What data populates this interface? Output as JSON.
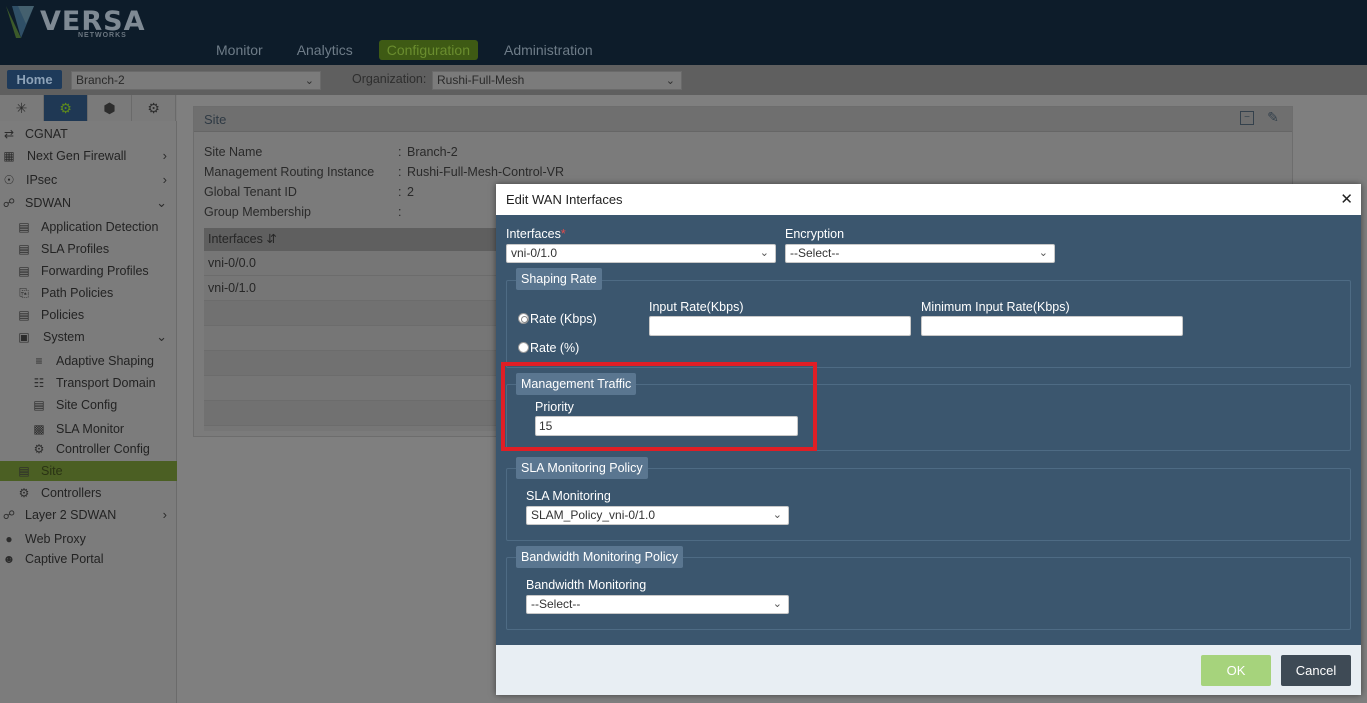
{
  "brand": {
    "name": "VERSA",
    "sub": "NETWORKS"
  },
  "nav": {
    "items": [
      "Monitor",
      "Analytics",
      "Configuration",
      "Administration"
    ],
    "active": "Configuration"
  },
  "subbar": {
    "home": "Home",
    "appliance": "Branch-2",
    "org_label": "Organization:",
    "org": "Rushi-Full-Mesh"
  },
  "sidebar": {
    "tab_icons": [
      "network-icon",
      "gear-icon",
      "cube-icon",
      "globe-gear-icon"
    ],
    "items": [
      {
        "label": "CGNAT",
        "icon": "nat-icon"
      },
      {
        "label": "Next Gen Firewall",
        "icon": "firewall-icon"
      },
      {
        "label": "IPsec",
        "icon": "globe-lock-icon"
      },
      {
        "label": "SDWAN",
        "icon": "sdwan-icon"
      },
      {
        "label": "Application Detection",
        "icon": "doc-icon"
      },
      {
        "label": "SLA Profiles",
        "icon": "doc-icon"
      },
      {
        "label": "Forwarding Profiles",
        "icon": "forward-icon"
      },
      {
        "label": "Path Policies",
        "icon": "path-icon"
      },
      {
        "label": "Policies",
        "icon": "policy-icon"
      },
      {
        "label": "System",
        "icon": "window-icon"
      },
      {
        "label": "Adaptive Shaping",
        "icon": "shaping-icon"
      },
      {
        "label": "Transport Domain",
        "icon": "transport-icon"
      },
      {
        "label": "Site Config",
        "icon": "doc-icon"
      },
      {
        "label": "SLA Monitor",
        "icon": "monitor-icon"
      },
      {
        "label": "Controller Config",
        "icon": "gear-net-icon"
      },
      {
        "label": "Site",
        "icon": "doc-icon"
      },
      {
        "label": "Controllers",
        "icon": "gear-net-icon"
      },
      {
        "label": "Layer 2 SDWAN",
        "icon": "sdwan-icon"
      },
      {
        "label": "Web Proxy",
        "icon": "proxy-icon"
      },
      {
        "label": "Captive Portal",
        "icon": "user-icon"
      }
    ]
  },
  "site": {
    "title": "Site",
    "fields": [
      {
        "key": "Site Name",
        "value": "Branch-2"
      },
      {
        "key": "Management Routing Instance",
        "value": "Rushi-Full-Mesh-Control-VR"
      },
      {
        "key": "Global Tenant ID",
        "value": "2"
      },
      {
        "key": "Group Membership",
        "value": ""
      }
    ],
    "interfaces_header": "Interfaces",
    "interfaces": [
      "vni-0/0.0",
      "vni-0/1.0"
    ]
  },
  "modal": {
    "title": "Edit WAN Interfaces",
    "interfaces_label": "Interfaces",
    "interfaces_value": "vni-0/1.0",
    "encryption_label": "Encryption",
    "encryption_value": "--Select--",
    "shaping": {
      "legend": "Shaping Rate",
      "rate_kbps": "Rate (Kbps)",
      "rate_pct": "Rate (%)",
      "input_rate_label": "Input Rate(Kbps)",
      "input_rate_value": "",
      "min_input_rate_label": "Minimum Input Rate(Kbps)",
      "min_input_rate_value": ""
    },
    "mgmt": {
      "legend": "Management Traffic",
      "priority_label": "Priority",
      "priority_value": "15"
    },
    "sla": {
      "legend": "SLA Monitoring Policy",
      "label": "SLA Monitoring",
      "value": "SLAM_Policy_vni-0/1.0"
    },
    "bw": {
      "legend": "Bandwidth Monitoring Policy",
      "label": "Bandwidth Monitoring",
      "value": "--Select--"
    },
    "ok": "OK",
    "cancel": "Cancel"
  }
}
